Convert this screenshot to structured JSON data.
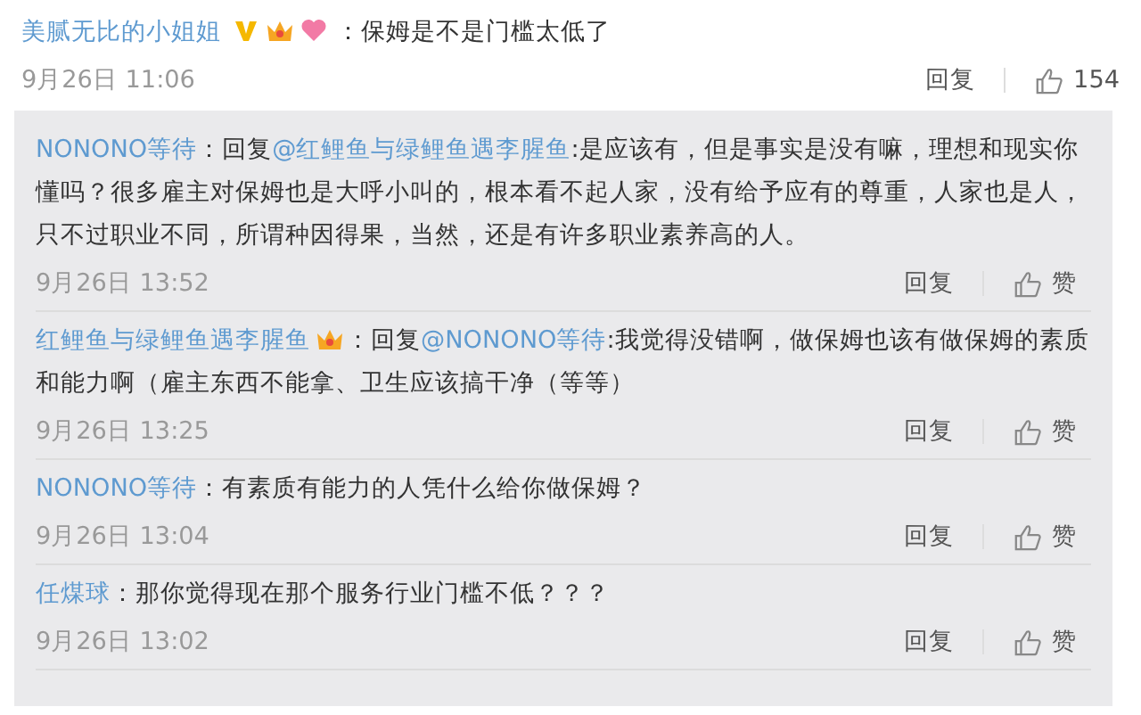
{
  "comment": {
    "author": "美腻无比的小姐姐",
    "badges": [
      {
        "kind": "v"
      },
      {
        "kind": "crown"
      },
      {
        "kind": "heart"
      }
    ],
    "text": "：保姆是不是门槛太低了",
    "time": "9月26日 11:06",
    "reply_label": "回复",
    "like_label": "154"
  },
  "replies": [
    {
      "author": "NONONO等待",
      "reply_prefix": "：回复",
      "mention": "@红鲤鱼与绿鲤鱼遇李腥鱼",
      "text": ":是应该有，但是事实是没有嘛，理想和现实你懂吗？很多雇主对保姆也是大呼小叫的，根本看不起人家，没有给予应有的尊重，人家也是人，只不过职业不同，所谓种因得果，当然，还是有许多职业素养高的人。",
      "time": "9月26日 13:52",
      "reply_label": "回复",
      "like_label": "赞"
    },
    {
      "author": "红鲤鱼与绿鲤鱼遇李腥鱼",
      "badges": [
        {
          "kind": "crown"
        }
      ],
      "reply_prefix": "：回复",
      "mention": "@NONONO等待",
      "text": ":我觉得没错啊，做保姆也该有做保姆的素质和能力啊（雇主东西不能拿、卫生应该搞干净（等等）",
      "time": "9月26日 13:25",
      "reply_label": "回复",
      "like_label": "赞"
    },
    {
      "author": "NONONO等待",
      "text": "：有素质有能力的人凭什么给你做保姆？",
      "time": "9月26日 13:04",
      "reply_label": "回复",
      "like_label": "赞"
    },
    {
      "author": "任煤球",
      "text": "：那你觉得现在那个服务行业门槛不低？？？",
      "time": "9月26日 13:02",
      "reply_label": "回复",
      "like_label": "赞"
    }
  ]
}
